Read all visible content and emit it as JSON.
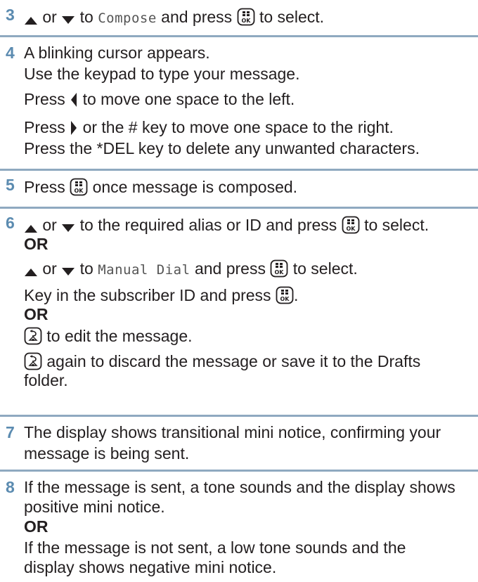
{
  "steps": [
    {
      "number": "3",
      "up_or": "or",
      "to": "to",
      "menu_item": "Compose",
      "and_press": "and press",
      "to_select": "to select."
    },
    {
      "number": "4",
      "line1": "A blinking cursor appears.",
      "line2": "Use the keypad to type your message.",
      "line3_a": "Press",
      "line3_b": "to move one space to the left.",
      "line4_a": "Press",
      "line4_b": "or the # key to move one space to the right.",
      "line5": "Press the *DEL key to delete any unwanted characters."
    },
    {
      "number": "5",
      "a": "Press",
      "b": "once message is composed."
    },
    {
      "number": "6",
      "l1_or": "or",
      "l1_b": "to the required alias or ID and press",
      "l1_c": "to select.",
      "or1": "OR",
      "l2_or": "or",
      "l2_to": "to",
      "l2_item": "Manual Dial",
      "l2_b": "and press",
      "l2_c": "to select.",
      "l3_a": "Key in the subscriber ID and press",
      "l3_b": ".",
      "or2": "OR",
      "l4": "to edit the message.",
      "l5": "again to discard the message or save it to the Drafts",
      "l6": "folder."
    },
    {
      "number": "7",
      "line1": "The display shows transitional mini notice, confirming your",
      "line2": "message is being sent."
    },
    {
      "number": "8",
      "line1": "If the message is sent, a tone sounds and the display shows",
      "line2": "positive mini notice.",
      "or": "OR",
      "line3": "If the message is not sent, a low tone sounds and the",
      "line4": "display shows negative mini notice."
    }
  ],
  "icons": {
    "up": "up-arrow-icon",
    "down": "down-arrow-icon",
    "left": "left-arrow-icon",
    "right": "right-arrow-icon",
    "ok": "menu-ok-key-icon",
    "back": "back-home-key-icon"
  },
  "colors": {
    "step_number": "#5b8bb0",
    "rule": "#8fa9c0",
    "text": "#231f20"
  }
}
